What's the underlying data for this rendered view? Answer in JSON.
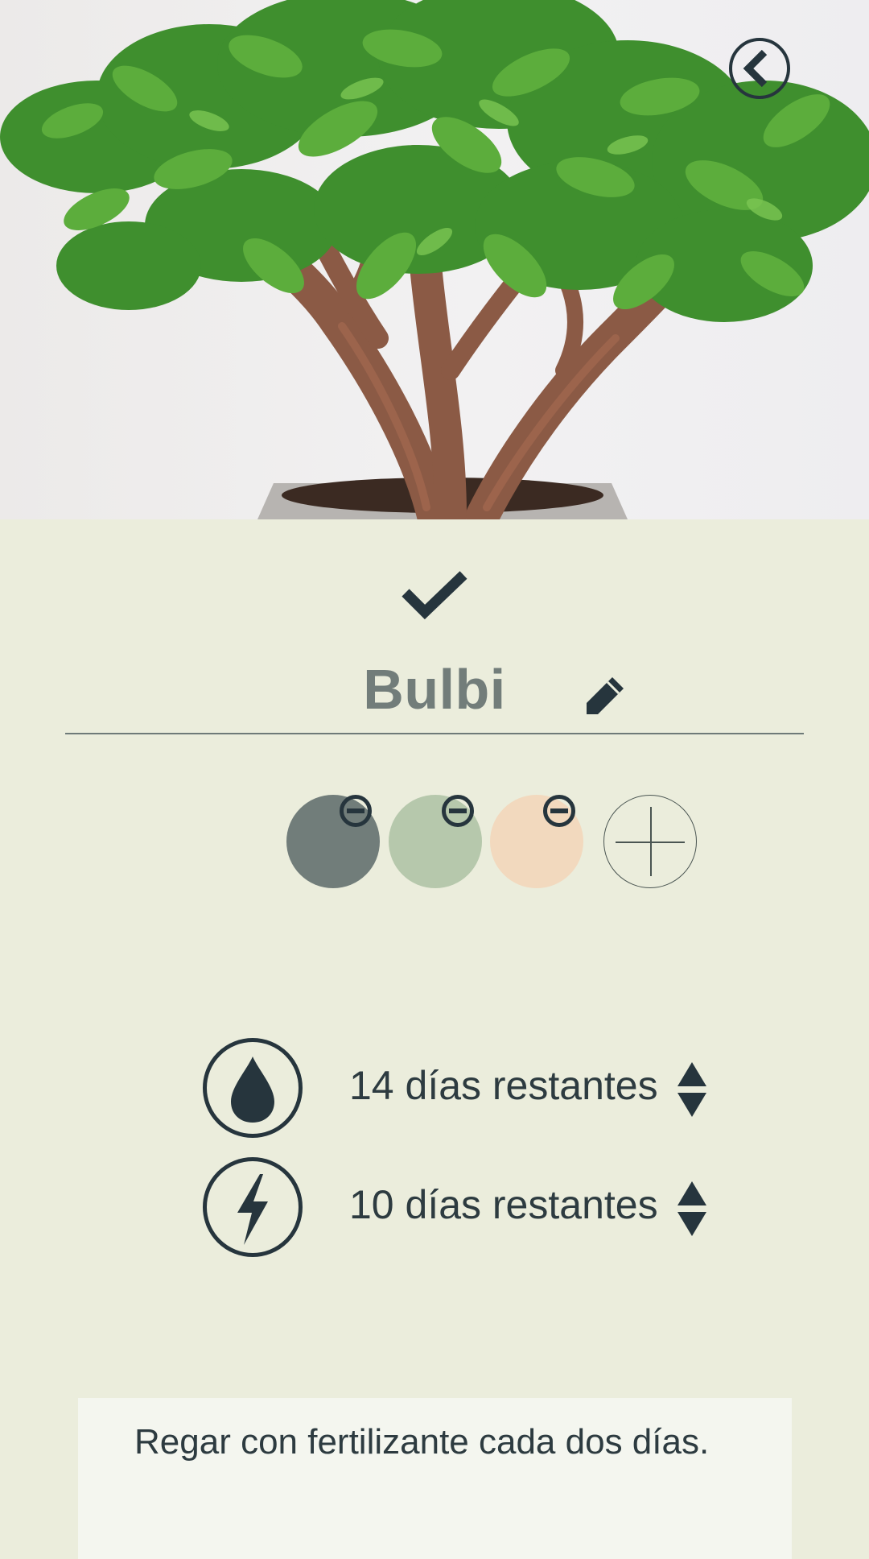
{
  "header": {
    "image_description": "jade-plant-photo",
    "back_icon": "chevron-left-icon"
  },
  "editor": {
    "confirm_icon": "check-icon",
    "plant_name": "Bulbi",
    "edit_icon": "pencil-icon"
  },
  "colors": {
    "swatches": [
      {
        "color": "#717d7a",
        "remove_icon": "minus-circle-icon"
      },
      {
        "color": "#b6c8ac",
        "remove_icon": "minus-circle-icon"
      },
      {
        "color": "#f2d9be",
        "remove_icon": "minus-circle-icon"
      }
    ],
    "add_icon": "plus-icon"
  },
  "reminders": [
    {
      "icon": "water-drop-icon",
      "text": "14 días restantes",
      "stepper": "up-down-arrows-icon"
    },
    {
      "icon": "lightning-bolt-icon",
      "text": "10 días restantes",
      "stepper": "up-down-arrows-icon"
    }
  ],
  "notes": {
    "text": "Regar con fertilizante cada dos días."
  },
  "theme": {
    "background": "#ebeddc",
    "ink": "#26353d",
    "name_color": "#727d7a",
    "notes_background": "#f4f6ef"
  }
}
